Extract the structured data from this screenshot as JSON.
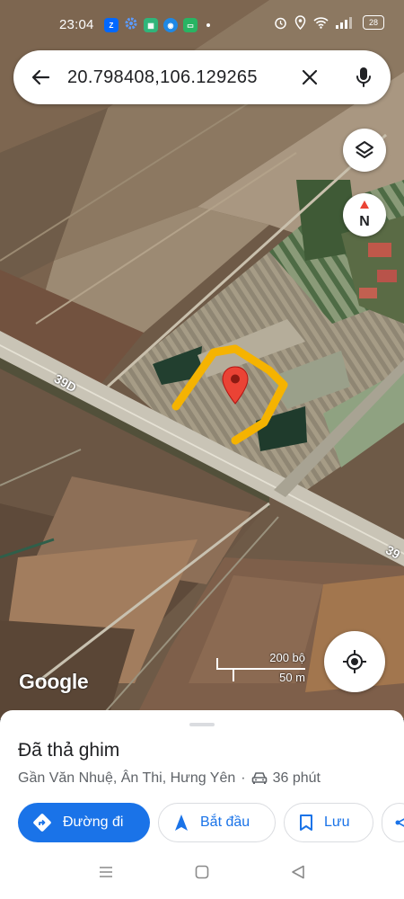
{
  "status_bar": {
    "time": "23:04",
    "app_icons": [
      "zalo-icon",
      "gear-icon",
      "calendar-icon",
      "browser-icon",
      "messages-icon"
    ],
    "battery": "28"
  },
  "search": {
    "query": "20.798408,106.129265"
  },
  "map": {
    "road_labels": [
      "39D",
      "39"
    ],
    "marker_color": "#ea4335",
    "highlight_color": "#f5b301",
    "google_label": "Google",
    "scale_imperial": "200 bộ",
    "scale_metric": "50 m"
  },
  "place": {
    "title": "Đã thả ghim",
    "address": "Gần Văn Nhuệ, Ân Thi, Hưng Yên",
    "separator": "·",
    "drive_time": "36 phút"
  },
  "actions": {
    "directions": "Đường đi",
    "start": "Bắt đầu",
    "save": "Lưu"
  },
  "colors": {
    "accent": "#1a73e8"
  }
}
